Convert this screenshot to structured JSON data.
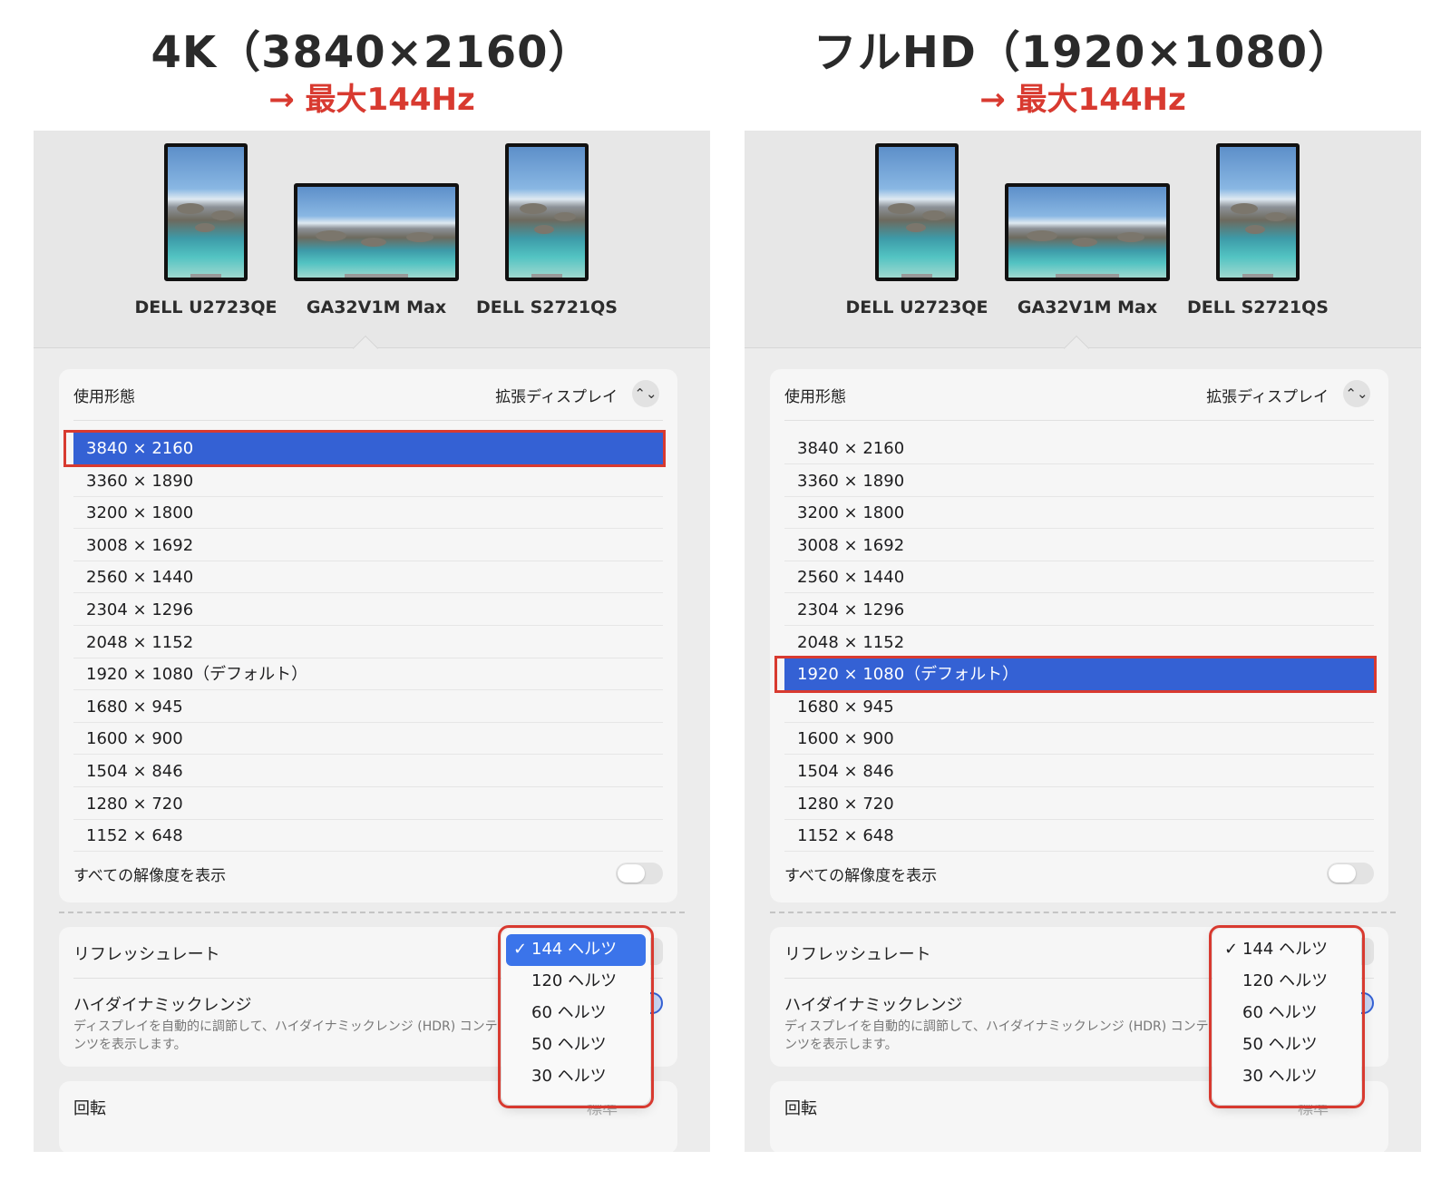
{
  "panels": [
    {
      "heading": "4K（3840×2160）",
      "subheading": "→ 最大144Hz",
      "displays": [
        "DELL U2723QE",
        "GA32V1M Max",
        "DELL S2721QS"
      ],
      "usage_label": "使用形態",
      "usage_value": "拡張ディスプレイ",
      "stepper_icon": "⌃⌄",
      "resolutions": [
        "3840 × 2160",
        "3360 × 1890",
        "3200 × 1800",
        "3008 × 1692",
        "2560 × 1440",
        "2304 × 1296",
        "2048 × 1152",
        "1920 × 1080（デフォルト）",
        "1680 × 945",
        "1600 × 900",
        "1504 × 846",
        "1280 × 720",
        "1152 × 648"
      ],
      "selected_index": 0,
      "show_all_label": "すべての解像度を表示",
      "refresh_label": "リフレッシュレート",
      "hdr_label": "ハイダイナミックレンジ",
      "hdr_desc": "ディスプレイを自動的に調節して、ハイダイナミックレンジ (HDR) コンテンツを表示します。",
      "rotation_label": "回転",
      "rotation_value": "標準",
      "refresh_options": [
        "144 ヘルツ",
        "120 ヘルツ",
        "60 ヘルツ",
        "50 ヘルツ",
        "30 ヘルツ"
      ],
      "refresh_selected_index": 0,
      "check_mark": "✓"
    },
    {
      "heading": "フルHD（1920×1080）",
      "subheading": "→ 最大144Hz",
      "displays": [
        "DELL U2723QE",
        "GA32V1M Max",
        "DELL S2721QS"
      ],
      "usage_label": "使用形態",
      "usage_value": "拡張ディスプレイ",
      "stepper_icon": "⌃⌄",
      "resolutions": [
        "3840 × 2160",
        "3360 × 1890",
        "3200 × 1800",
        "3008 × 1692",
        "2560 × 1440",
        "2304 × 1296",
        "2048 × 1152",
        "1920 × 1080（デフォルト）",
        "1680 × 945",
        "1600 × 900",
        "1504 × 846",
        "1280 × 720",
        "1152 × 648"
      ],
      "selected_index": 7,
      "show_all_label": "すべての解像度を表示",
      "refresh_label": "リフレッシュレート",
      "hdr_label": "ハイダイナミックレンジ",
      "hdr_desc": "ディスプレイを自動的に調節して、ハイダイナミックレンジ (HDR) コンテンツを表示します。",
      "rotation_label": "回転",
      "rotation_value": "標準",
      "refresh_options": [
        "144 ヘルツ",
        "120 ヘルツ",
        "60 ヘルツ",
        "50 ヘルツ",
        "30 ヘルツ"
      ],
      "refresh_selected_index": 0,
      "check_mark": "✓"
    }
  ],
  "colors": {
    "highlight_red": "#d83a30",
    "selection_blue": "#3461d4",
    "menu_blue": "#3b74ea"
  }
}
